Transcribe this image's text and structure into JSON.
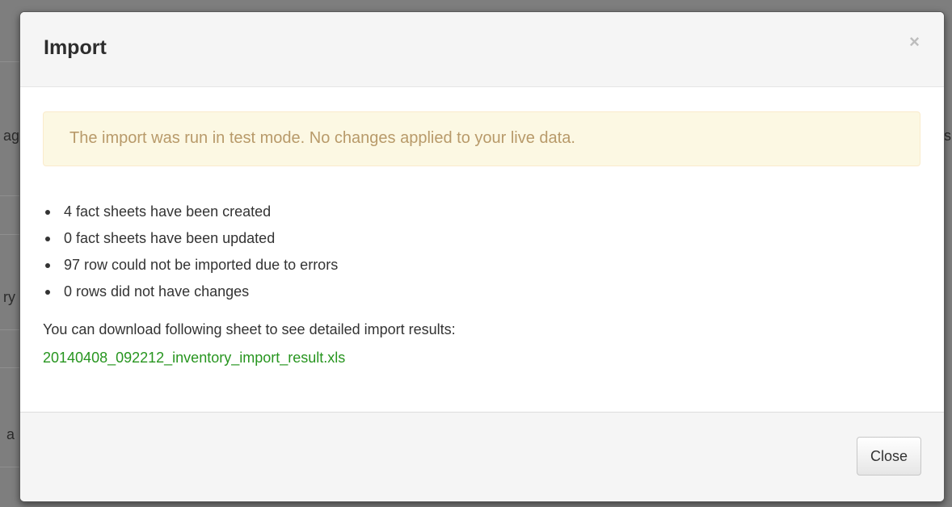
{
  "background": {
    "fragments": [
      "ag",
      "ry",
      "a",
      "s"
    ]
  },
  "modal": {
    "title": "Import",
    "close_icon_glyph": "×",
    "alert": {
      "text": "The import was run in test mode. No changes applied to your live data."
    },
    "results": [
      "4 fact sheets have been created",
      "0 fact sheets have been updated",
      "97 row could not be imported due to errors",
      "0 rows did not have changes"
    ],
    "download_text": "You can download following sheet to see detailed import results:",
    "download_link": "20140408_092212_inventory_import_result.xls",
    "footer": {
      "close_label": "Close"
    }
  },
  "colors": {
    "alert_background": "#fcf8e3",
    "alert_text": "#b89a6a",
    "link": "#27951f",
    "backdrop": "#7e7e7e"
  },
  "icons": {
    "close": "close-icon"
  }
}
